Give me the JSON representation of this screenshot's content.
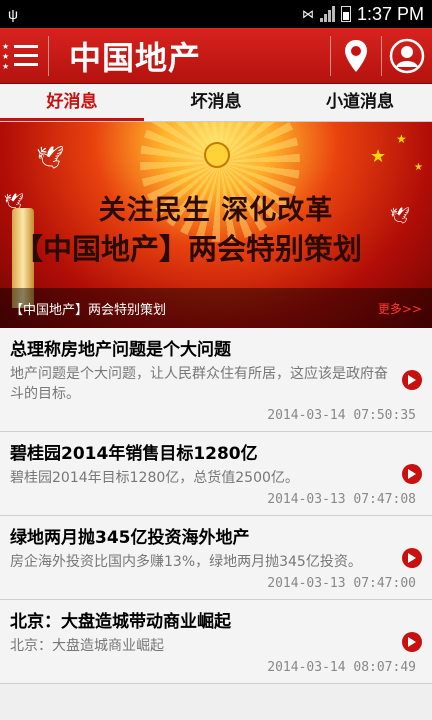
{
  "status_bar": {
    "time": "1:37 PM"
  },
  "header": {
    "brand": "中国地产"
  },
  "tabs": [
    {
      "label": "好消息",
      "active": true
    },
    {
      "label": "坏消息",
      "active": false
    },
    {
      "label": "小道消息",
      "active": false
    }
  ],
  "banner": {
    "headline1": "关注民生 深化改革",
    "headline2": "【中国地产】两会特别策划",
    "caption": "【中国地产】两会特别策划",
    "more": "更多>>"
  },
  "news": [
    {
      "title": "总理称房地产问题是个大问题",
      "summary": "地产问题是个大问题，让人民群众住有所居，这应该是政府奋斗的目标。",
      "time": "2014-03-14 07:50:35"
    },
    {
      "title": "碧桂园2014年销售目标1280亿",
      "summary": "碧桂园2014年目标1280亿，总货值2500亿。",
      "time": "2014-03-13 07:47:08"
    },
    {
      "title": "绿地两月抛345亿投资海外地产",
      "summary": "房企海外投资比国内多赚13%，绿地两月抛345亿投资。",
      "time": "2014-03-13 07:47:00"
    },
    {
      "title": "北京：大盘造城带动商业崛起",
      "summary": "北京：大盘造城商业崛起",
      "time": "2014-03-14 08:07:49"
    }
  ],
  "colors": {
    "brand_red": "#c8100f",
    "appbar_red": "#d8231f"
  }
}
